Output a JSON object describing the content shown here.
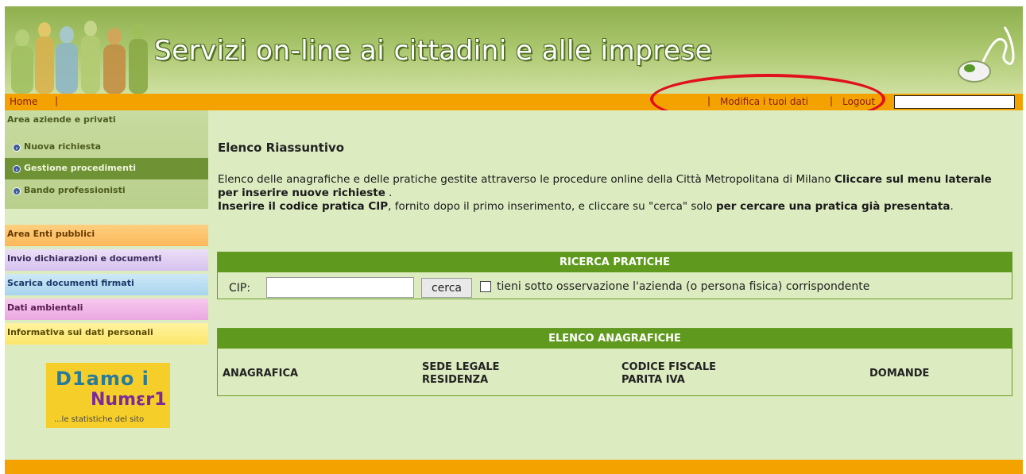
{
  "header": {
    "title": "Servizi on-line ai cittadini e alle imprese"
  },
  "topnav": {
    "home": "Home",
    "modifica": "Modifica i tuoi dati",
    "logout": "Logout",
    "separator": "|"
  },
  "sidebar": {
    "area_aziende": "Area aziende e privati",
    "items": [
      {
        "label": "Nuova richiesta"
      },
      {
        "label": "Gestione procedimenti"
      },
      {
        "label": "Bando professionisti"
      }
    ],
    "area_enti": "Area Enti pubblici",
    "invio": "Invio dichiarazioni e documenti",
    "scarica": "Scarica documenti firmati",
    "dati_ambientali": "Dati ambientali",
    "informativa": "Informativa sui dati personali",
    "diamo": {
      "line1": "D1amo i",
      "line2": "Numεr1",
      "line3": "...le statistiche del sito"
    }
  },
  "main": {
    "title": "Elenco Riassuntivo",
    "intro": {
      "p1": "Elenco delle anagrafiche e delle pratiche gestite attraverso le procedure online della Città Metropolitana di Milano ",
      "p1_bold": "Cliccare sul menu laterale per inserire nuove richieste",
      "p1_end": " .",
      "p2_bold": "Inserire il codice pratica CIP",
      "p2": ", fornito dopo il primo inserimento, e cliccare su \"cerca\" solo ",
      "p2_bold2": "per cercare una pratica già presentata",
      "p2_end": "."
    },
    "ricerca": {
      "header": "RICERCA PRATICHE",
      "cip_label": "CIP:",
      "cip_value": "",
      "button": "cerca",
      "checkbox_label": "tieni sotto osservazione l'azienda (o persona fisica) corrispondente"
    },
    "elenco": {
      "header": "ELENCO ANAGRAFICHE",
      "columns": {
        "anagrafica": "ANAGRAFICA",
        "sede_1": "SEDE LEGALE",
        "sede_2": "RESIDENZA",
        "codice_1": "CODICE FISCALE",
        "codice_2": "PARITA IVA",
        "domande": "DOMANDE"
      }
    }
  },
  "colors": {
    "accent_orange": "#f4a200",
    "panel_green": "#5f9a1e",
    "background_green": "#dcebc0",
    "highlight_red": "#e0101c"
  }
}
